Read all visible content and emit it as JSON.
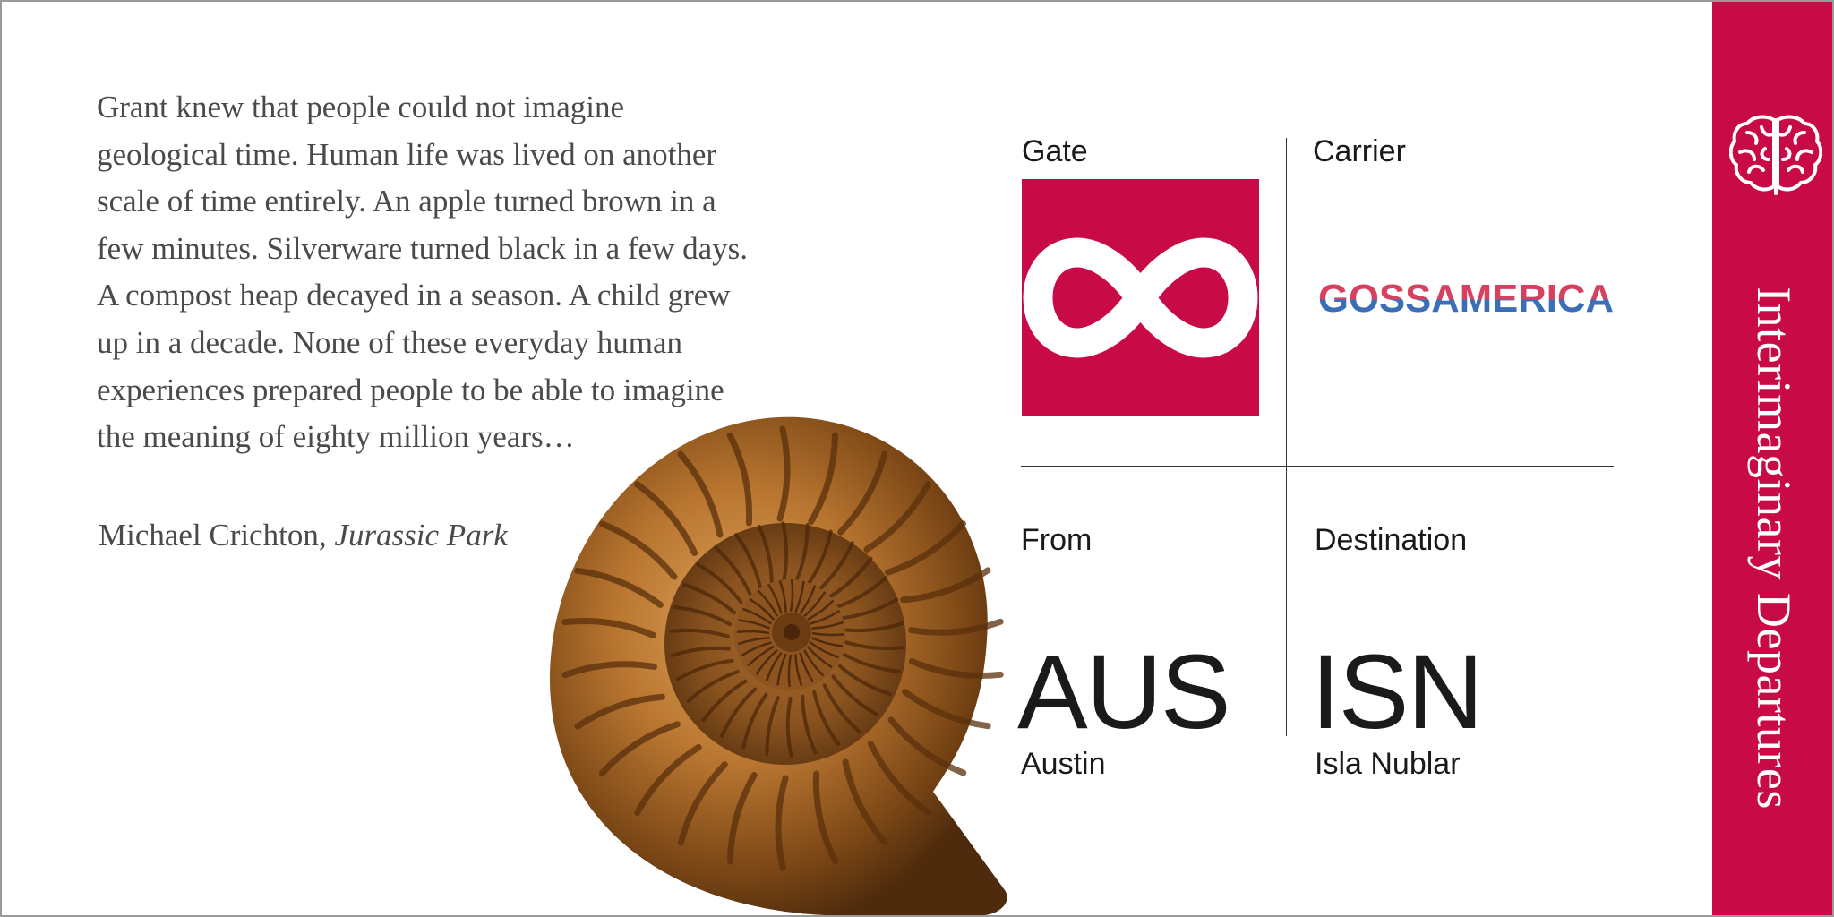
{
  "quote": {
    "lines": [
      "Grant knew that people could not imagine",
      "geological time. Human life was lived on another",
      "scale of time entirely. An apple turned brown in a",
      "few minutes. Silverware turned black in a few days.",
      "A compost heap decayed in a season. A child grew",
      "up in a decade. None of these everyday human",
      "experiences prepared people to be able to imagine",
      "the meaning of eighty million years…"
    ],
    "author": "Michael Crichton,",
    "work": "Jurassic Park"
  },
  "boarding": {
    "gate_label": "Gate",
    "gate_symbol": "infinity-icon",
    "carrier_label": "Carrier",
    "carrier_name": "GOSSAMERICA",
    "from_label": "From",
    "from_code": "AUS",
    "from_city": "Austin",
    "destination_label": "Destination",
    "destination_code": "ISN",
    "destination_city": "Isla Nublar"
  },
  "sidebar": {
    "title": "Interimaginary Departures",
    "logo_icon": "brain-icon"
  },
  "colors": {
    "accent": "#c80a46",
    "carrier_red": "#d8405f",
    "carrier_blue": "#3a6fb8",
    "text": "#1a1a1a",
    "quote_text": "#4a4a4a"
  }
}
